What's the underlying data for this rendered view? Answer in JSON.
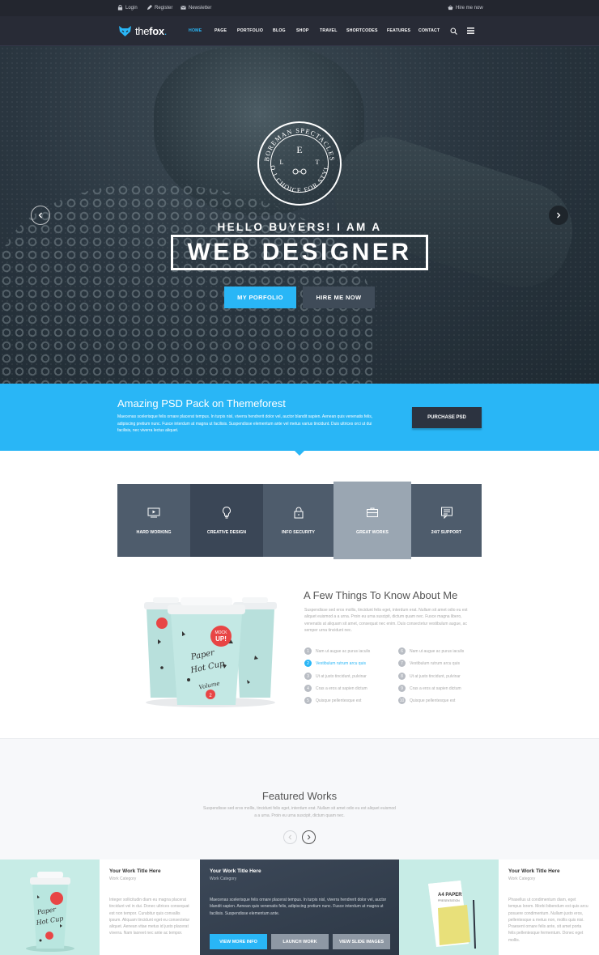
{
  "topbar": {
    "login": "Login",
    "register": "Register",
    "newsletter": "Newsletter",
    "hire": "Hire me now"
  },
  "logo": {
    "brand_light": "the",
    "brand_bold": "fox"
  },
  "nav": {
    "items": [
      "HOME",
      "PAGE",
      "PORTFOLIO",
      "BLOG",
      "SHOP",
      "TRAVEL",
      "SHORTCODES",
      "FEATURES",
      "CONTACT"
    ]
  },
  "hero": {
    "badge_top": "BOREMAN SPECTACLES",
    "badge_bottom": "NO 1 CHOICE FOR STYLE",
    "badge_left": "L",
    "badge_center": "E",
    "badge_right": "T",
    "hello": "HELLO BUYERS! I AM A",
    "headline": "WEB DESIGNER",
    "btn_portfolio": "MY PORFOLIO",
    "btn_hire": "HIRE ME NOW"
  },
  "band": {
    "title": "Amazing PSD Pack on Themeforest",
    "text": "Maecenas scelerisque felis ornare placerat tempus. In turpis nisl, viverra hendrerit dolor vel, auctor blandit sapien. Aenean quis venenatis felis, adipiscing pretium nunc. Fusce interdum at magna ut facilisis. Suspendisse elementum ante vel metus varius tincidunt. Duis ultrices orci ut dui facilisis, nec viverra lectus aliquet.",
    "button": "PURCHASE PSD"
  },
  "features": [
    {
      "label": "HARD WORKING",
      "icon": "video-icon",
      "color": "#4e5c6c"
    },
    {
      "label": "CREATIVE DESIGN",
      "icon": "lightbulb-icon",
      "color": "#3a4656"
    },
    {
      "label": "INFO SECURITY",
      "icon": "lock-icon",
      "color": "#4e5c6c"
    },
    {
      "label": "GREAT WORKS",
      "icon": "briefcase-icon",
      "color": "#9aa6b2"
    },
    {
      "label": "24/7 SUPPORT",
      "icon": "chat-icon",
      "color": "#4e5c6c"
    }
  ],
  "about": {
    "title": "A Few Things To Know About Me",
    "text": "Suspendisse sed eros mollis, tincidunt felis eget, interdum erat. Nullam sit amet odio eu est aliquet euismod a a urna. Proin eu urna suscipit, dictum quam nec. Fusce magna libero, venenatis at aliquam sit amet, consequat nec enim. Duis consectetur vestibulum augue, ac semper urna tincidunt nec.",
    "list_left": [
      {
        "n": "1",
        "text": "Nam ut augue ac purus iaculis"
      },
      {
        "n": "2",
        "text": "Vestibulum rutrum arcu quis"
      },
      {
        "n": "3",
        "text": "Ut at justo tincidunt, pulvinar"
      },
      {
        "n": "4",
        "text": "Cras a eros at sapien dictum"
      },
      {
        "n": "5",
        "text": "Quisque pellentesque est"
      }
    ],
    "list_right": [
      {
        "n": "6",
        "text": "Nam ut augue ac purus iaculis"
      },
      {
        "n": "7",
        "text": "Vestibulum rutrum arcu quis"
      },
      {
        "n": "8",
        "text": "Ut at justo tincidunt, pulvinar"
      },
      {
        "n": "9",
        "text": "Cras a eros at sapien dictum"
      },
      {
        "n": "10",
        "text": "Quisque pellentesque est"
      }
    ],
    "cup_text": {
      "mock": "MOCK",
      "up": "UP!",
      "paper": "Paper",
      "hotcup": "Hot Cup",
      "volume": "Volume",
      "vol_num": "2"
    }
  },
  "featured": {
    "title": "Featured Works",
    "text": "Suspendisse sed eros mollis, tincidunt felis eget, interdum erat. Nullam sit amet odio eu est aliquet euismod a a urna. Proin eu urna suscipit, dictum quam nec."
  },
  "works": [
    {
      "title": "Your Work Title Here",
      "category": "Work Category",
      "text": "Integer sollicitudin diam eu magna placerat tincidunt vel in dui. Donec ultrices consequat est non tempor. Curabitur quis convallis ipsum. Aliquam tincidunt eget eu consectetur aliquet. Aenean vitae metus id justo placerat viverra. Nam laoreet nec ante ac tempor."
    },
    {
      "title": "Your Work Title Here",
      "category": "Work Category",
      "text": "Maecenas scelerisque felis ornare placerat tempus. In turpis nisl, viverra hendrerit dolor vel, auctor blandit sapien. Aenean quis venenatis felis, adipiscing pretium nunc. Fusce interdum at magna ut facilisis. Suspendisse elementum ante.",
      "btn_info": "VIEW MORE INFO",
      "btn_launch": "LAUNCH WORK",
      "btn_slide": "VIEW SLIDE IMAGES"
    },
    {
      "title": "Your Work Title Here",
      "category": "Work Category",
      "text": "Phasellus ut condimentum diam, eget tempus lorem. Morbi bibendum est quis arcu posuere condimentum. Nullam justo eros, pellentesque a metus non, mollis quis nisi. Praesent ornare felis ante, sit amet porta felis pellentesque fermentum. Donec eget mollis."
    }
  ],
  "work_card": {
    "a4": "A4 PAPER",
    "presentation": "PRESENTATION"
  },
  "colors": {
    "accent": "#29b6f6",
    "dark": "#282b36",
    "band": "#29b6f6"
  }
}
